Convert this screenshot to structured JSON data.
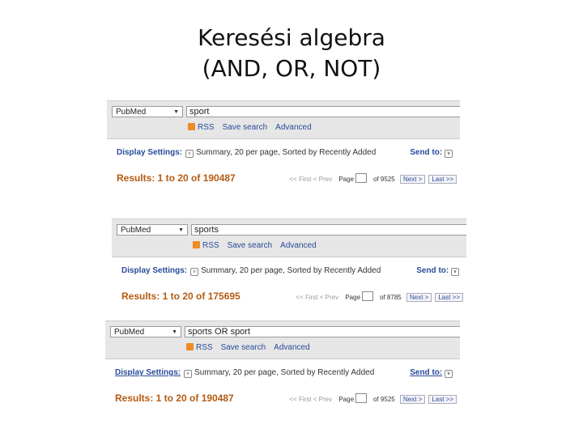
{
  "slide": {
    "title_line1": "Keresési algebra",
    "title_line2": "(AND, OR, NOT)"
  },
  "panels": [
    {
      "database": "PubMed",
      "query": "sport",
      "links": [
        "RSS",
        "Save search",
        "Advanced"
      ],
      "display_label": "Display Settings:",
      "display_value": "Summary, 20 per page, Sorted by Recently Added",
      "send_to": "Send to:",
      "results": "Results: 1 to 20 of 190487",
      "pager": {
        "first": "<< First",
        "prev": "< Prev",
        "page_label": "Page",
        "of_pages": "of 9525",
        "next": "Next >",
        "last": "Last >>"
      }
    },
    {
      "database": "PubMed",
      "query": "sports",
      "links": [
        "RSS",
        "Save search",
        "Advanced"
      ],
      "display_label": "Display Settings:",
      "display_value": "Summary, 20 per page, Sorted by Recently Added",
      "send_to": "Send to:",
      "results": "Results: 1 to 20 of 175695",
      "pager": {
        "first": "<< First",
        "prev": "< Prev",
        "page_label": "Page",
        "of_pages": "of 8785",
        "next": "Next >",
        "last": "Last >>"
      }
    },
    {
      "database": "PubMed",
      "query": "sports OR sport",
      "links": [
        "RSS",
        "Save search",
        "Advanced"
      ],
      "display_label": "Display Settings:",
      "display_value": "Summary, 20 per page, Sorted by Recently Added",
      "send_to": "Send to:",
      "results": "Results: 1 to 20 of 190487",
      "pager": {
        "first": "<< First",
        "prev": "< Prev",
        "page_label": "Page",
        "of_pages": "of 9525",
        "next": "Next >",
        "last": "Last >>"
      }
    }
  ]
}
